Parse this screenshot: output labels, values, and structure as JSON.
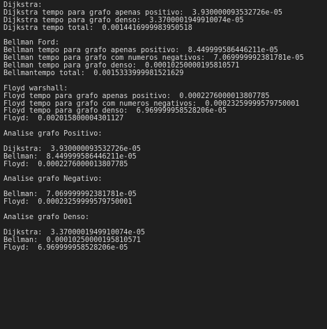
{
  "terminal": {
    "lines": [
      "Dijkstra:",
      "Dijkstra tempo para grafo apenas positivo:  3.930000093532726e-05",
      "Dijkstra tempo para grafo denso:  3.3700001949910074e-05",
      "Dijkstra tempo total:  0.0014416999983950518",
      "",
      "Bellman Ford:",
      "Bellman tempo para grafo apenas positivo:  8.449999586446211e-05",
      "Bellman tempo para grafo com numeros negativos:  7.069999992381781e-05",
      "Bellman tempo para grafo denso:  0.00010250000195810571",
      "Bellmantempo total:  0.0015333999981521629",
      "",
      "Floyd warshall:",
      "Floyd tempo para grafo apenas positivo:  0.0002276000013807785",
      "Floyd tempo para grafo com numeros negativos:  0.00023259999579750001",
      "Floyd tempo para grafo denso:  6.969999958528206e-05",
      "Floyd:  0.002015800004301127",
      "",
      "Analise grafo Positivo:",
      "",
      "Dijkstra:  3.930000093532726e-05",
      "Bellman:  8.449999586446211e-05",
      "Floyd:  0.0002276000013807785",
      "",
      "Analise grafo Negativo:",
      "",
      "Bellman:  7.069999992381781e-05",
      "Floyd:  0.00023259999579750001",
      "",
      "Analise grafo Denso:",
      "",
      "Dijkstra:  3.3700001949910074e-05",
      "Bellman:  0.00010250000195810571",
      "Floyd:  6.969999958528206e-05"
    ]
  }
}
